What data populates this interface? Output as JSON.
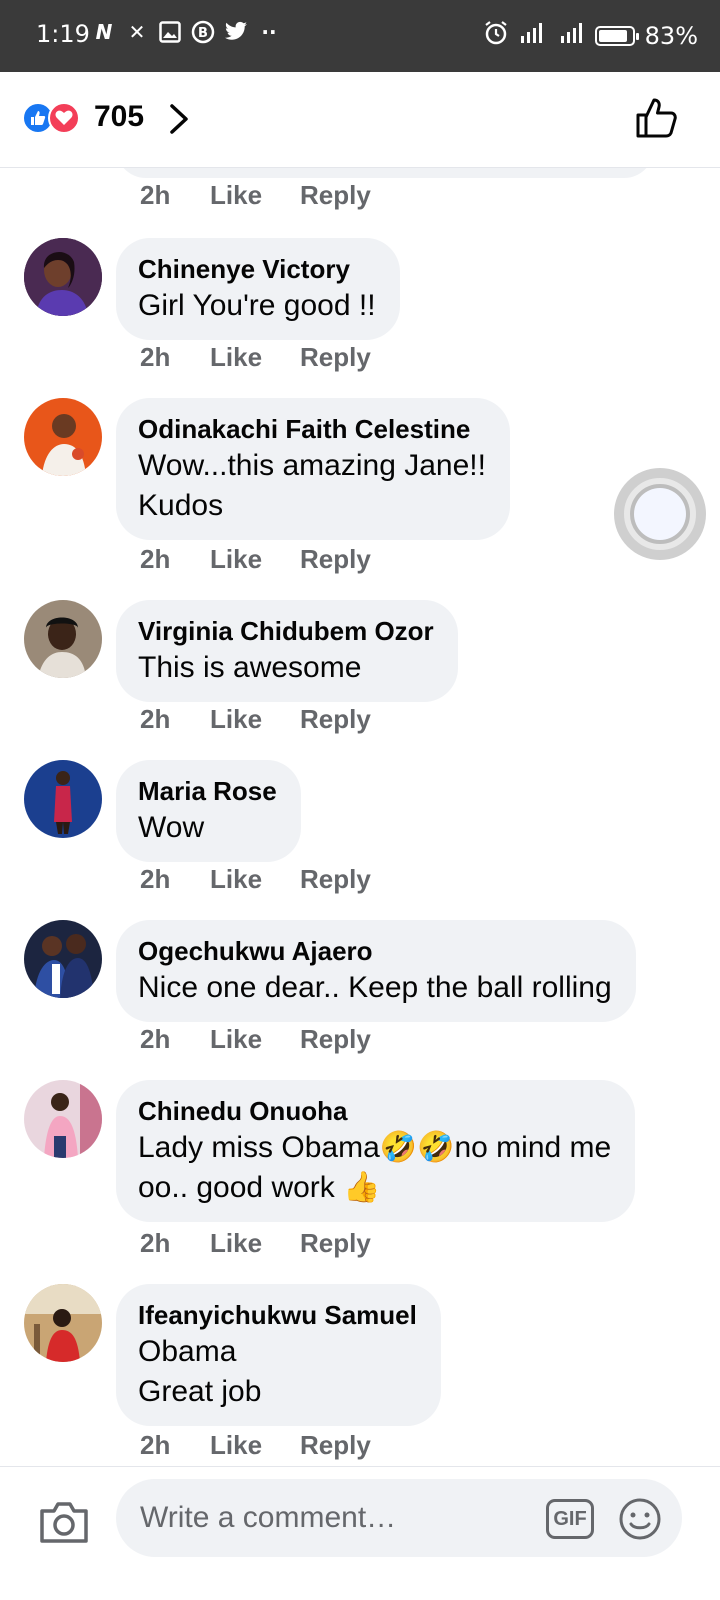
{
  "status_bar": {
    "time": "1:19",
    "battery": "83%",
    "left_icons": [
      "netflix-icon",
      "x-icon",
      "gallery-icon",
      "b-circle-icon",
      "twitter-icon",
      "more-dots-icon"
    ],
    "right_icons": [
      "alarm-icon",
      "signal-icon",
      "signal-icon-2",
      "battery-icon"
    ]
  },
  "header": {
    "reaction_count": "705",
    "reactions": [
      "like",
      "love"
    ]
  },
  "partial_comment": {
    "time": "2h",
    "like": "Like",
    "reply": "Reply"
  },
  "comments": [
    {
      "name": "Chinenye Victory",
      "text": "Girl You're good !!",
      "time": "2h",
      "like": "Like",
      "reply": "Reply",
      "avatar_color": "#3b2142"
    },
    {
      "name": "Odinakachi Faith Celestine",
      "text": "Wow...this amazing Jane!!\nKudos",
      "time": "2h",
      "like": "Like",
      "reply": "Reply",
      "avatar_color": "#e8561a"
    },
    {
      "name": "Virginia Chidubem Ozor",
      "text": "This is awesome",
      "time": "2h",
      "like": "Like",
      "reply": "Reply",
      "avatar_color": "#8a7a6a"
    },
    {
      "name": "Maria Rose",
      "text": "Wow",
      "time": "2h",
      "like": "Like",
      "reply": "Reply",
      "avatar_color": "#1b3f8f"
    },
    {
      "name": "Ogechukwu Ajaero",
      "text": "Nice one dear.. Keep the ball rolling",
      "time": "2h",
      "like": "Like",
      "reply": "Reply",
      "avatar_color": "#22305a"
    },
    {
      "name": "Chinedu Onuoha",
      "text": "Lady miss Obama🤣🤣no mind me\noo.. good work 👍",
      "time": "2h",
      "like": "Like",
      "reply": "Reply",
      "avatar_color": "#d9a0b4"
    },
    {
      "name": "Ifeanyichukwu Samuel",
      "text": "Obama\nGreat job",
      "time": "2h",
      "like": "Like",
      "reply": "Reply",
      "avatar_color": "#b58a52"
    }
  ],
  "composer": {
    "placeholder": "Write a comment…",
    "gif_label": "GIF"
  },
  "colors": {
    "bubble": "#f0f2f5",
    "meta_text": "#65676b",
    "like_blue": "#1877f2",
    "love_red": "#f33e58",
    "status_bar": "#3a3a3a"
  }
}
